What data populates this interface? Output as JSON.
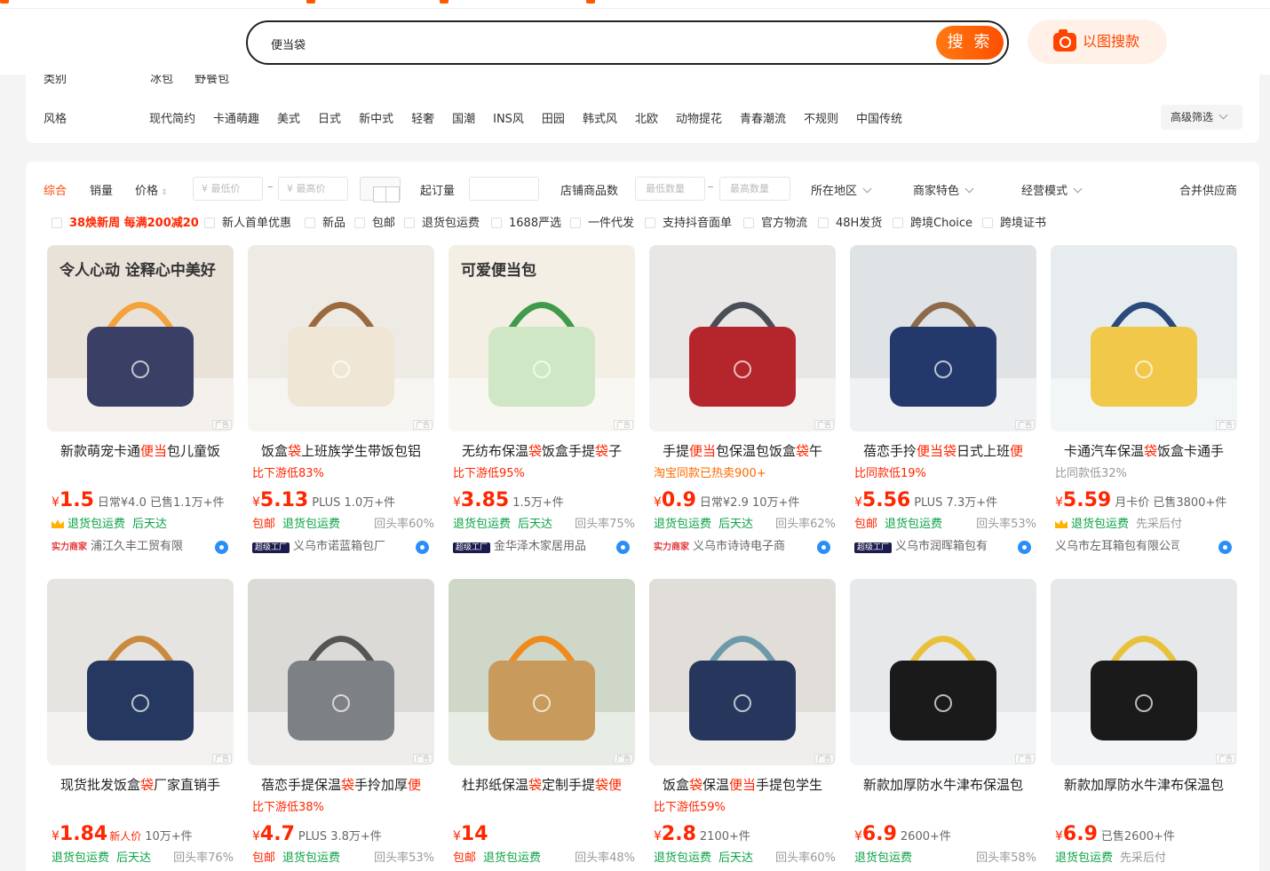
{
  "search": {
    "value": "便当袋",
    "button": "搜 索",
    "image_search": "以图搜款"
  },
  "filters": {
    "rows": [
      {
        "key": "类别",
        "values": [
          "冰包",
          "野餐包"
        ]
      },
      {
        "key": "风格",
        "values": [
          "现代简约",
          "卡通萌趣",
          "美式",
          "日式",
          "新中式",
          "轻奢",
          "国潮",
          "INS风",
          "田园",
          "韩式风",
          "北欧",
          "动物提花",
          "青春潮流",
          "不规则",
          "中国传统"
        ]
      }
    ],
    "advanced": "高级筛选"
  },
  "sort": {
    "comprehensive": "综合",
    "sales": "销量",
    "price": "价格",
    "min_price": "¥ 最低价",
    "max_price": "¥ 最高价",
    "moq": "起订量",
    "shop_count": "店铺商品数",
    "min_qty": "最低数量",
    "max_qty": "最高数量",
    "region": "所在地区",
    "features": "商家特色",
    "mode": "经营模式",
    "merge": "合并供应商"
  },
  "checks": [
    "38焕新周 每满200减20",
    "新人首单优惠",
    "新品",
    "包邮",
    "退货包运费",
    "1688严选",
    "一件代发",
    "支持抖音面单",
    "官方物流",
    "48H发货",
    "跨境Choice",
    "跨境证书"
  ],
  "products": [
    {
      "title": "新款萌宠卡通便当包儿童饭",
      "sub": "",
      "price": "1.5",
      "meta": "日常¥4.0 已售1.1万+件",
      "tags": [
        "退货包运费",
        "后天达"
      ],
      "crown": true,
      "rate": "",
      "badge": "实力商家",
      "shop": "浦江久丰工贸有限",
      "img": {
        "bg": "#e9e2d8",
        "bag": "#3a3f66",
        "accent": "#f4a23c",
        "text": "令人心动 诠释心中美好"
      }
    },
    {
      "title": "饭盒袋上班族学生带饭包铝",
      "sub": "比下游低83%",
      "price": "5.13",
      "meta": "PLUS 1.0万+件",
      "tags": [
        "包邮",
        "退货包运费"
      ],
      "crown": false,
      "rate": "回头率60%",
      "badge": "超级工厂",
      "shop": "义乌市诺蓝箱包厂",
      "img": {
        "bg": "#eeeae4",
        "bag": "#efe6d6",
        "accent": "#9a6a3e",
        "text": ""
      }
    },
    {
      "title": "无纺布保温袋饭盒手提袋子",
      "sub": "比下游低95%",
      "price": "3.85",
      "meta": "1.5万+件",
      "tags": [
        "退货包运费",
        "后天达"
      ],
      "crown": false,
      "rate": "回头率75%",
      "badge": "超级工厂",
      "shop": "金华泽木家居用品",
      "img": {
        "bg": "#f3efe4",
        "bag": "#cfe7c4",
        "accent": "#3f9a4b",
        "text": "可爱便当包"
      }
    },
    {
      "title": "手提便当包保温包饭盒袋午",
      "sub": "淘宝同款已热卖900+",
      "price": "0.9",
      "meta": "日常¥2.9 10万+件",
      "tags": [
        "退货包运费",
        "后天达"
      ],
      "crown": false,
      "rate": "回头率62%",
      "badge": "实力商家",
      "shop": "义乌市诗诗电子商",
      "img": {
        "bg": "#e9e7e5",
        "bag": "#b5252c",
        "accent": "#4a4f57",
        "text": ""
      }
    },
    {
      "title": "蓓恋手拎便当袋日式上班便",
      "sub": "比同款低19%",
      "price": "5.56",
      "meta": "PLUS 7.3万+件",
      "tags": [
        "包邮",
        "退货包运费"
      ],
      "crown": false,
      "rate": "回头率53%",
      "badge": "超级工厂",
      "shop": "义乌市润晖箱包有",
      "img": {
        "bg": "#dfe3e6",
        "bag": "#23386b",
        "accent": "#8d6a4a",
        "text": ""
      }
    },
    {
      "title": "卡通汽车保温袋饭盒卡通手",
      "sub": "比同款低32%",
      "price": "5.59",
      "meta": "月卡价 已售3800+件",
      "tags": [
        "退货包运费",
        "先采后付"
      ],
      "crown": true,
      "rate": "",
      "badge": "",
      "shop": "义乌市左耳箱包有限公司",
      "img": {
        "bg": "#e7ecee",
        "bag": "#f2c84b",
        "accent": "#2b4a7c",
        "text": ""
      }
    },
    {
      "title": "现货批发饭盒袋厂家直销手",
      "sub": "",
      "price": "1.84",
      "meta": "10万+件",
      "tag_price": "新人价",
      "tags": [
        "退货包运费",
        "后天达"
      ],
      "crown": false,
      "rate": "回头率76%",
      "badge": "",
      "shop": "",
      "img": {
        "bg": "#e6e4e0",
        "bag": "#25385f",
        "accent": "#c98a3d",
        "text": ""
      }
    },
    {
      "title": "蓓恋手提保温袋手拎加厚便",
      "sub": "比下游低38%",
      "price": "4.7",
      "meta": "PLUS 3.8万+件",
      "tags": [
        "包邮",
        "退货包运费"
      ],
      "crown": false,
      "rate": "回头率53%",
      "badge": "",
      "shop": "",
      "img": {
        "bg": "#dcdad7",
        "bag": "#7d8085",
        "accent": "#555",
        "text": ""
      }
    },
    {
      "title": "杜邦纸保温袋定制手提袋便",
      "sub": "",
      "price": "14",
      "meta": "",
      "tags": [
        "包邮",
        "退货包运费"
      ],
      "crown": false,
      "rate": "回头率48%",
      "badge": "",
      "shop": "",
      "img": {
        "bg": "#cfd8c8",
        "bag": "#c89a5c",
        "accent": "#f08a1d",
        "text": ""
      }
    },
    {
      "title": "饭盒袋保温便当手提包学生",
      "sub": "比下游低59%",
      "price": "2.8",
      "meta": "2100+件",
      "tags": [
        "退货包运费",
        "后天达"
      ],
      "crown": false,
      "rate": "回头率60%",
      "badge": "",
      "shop": "",
      "img": {
        "bg": "#e1ddd8",
        "bag": "#26365c",
        "accent": "#6c9aa8",
        "text": ""
      }
    },
    {
      "title": "新款加厚防水牛津布保温包",
      "sub": "",
      "price": "6.9",
      "meta": "2600+件",
      "tags": [
        "退货包运费"
      ],
      "crown": false,
      "rate": "回头率58%",
      "badge": "",
      "shop": "",
      "img": {
        "bg": "#e6e8ea",
        "bag": "#1a1a1a",
        "accent": "#e9c03a",
        "text": ""
      }
    },
    {
      "title": "新款加厚防水牛津布保温包",
      "sub": "",
      "price": "6.9",
      "meta": "已售2600+件",
      "tags": [
        "退货包运费",
        "先采后付"
      ],
      "crown": false,
      "rate": "",
      "badge": "",
      "shop": "",
      "img": {
        "bg": "#e6e8ea",
        "bag": "#1a1a1a",
        "accent": "#e9c03a",
        "text": ""
      }
    }
  ],
  "colors": {
    "accent": "#ff4400",
    "price": "#ff2600",
    "green": "#0aa245"
  }
}
